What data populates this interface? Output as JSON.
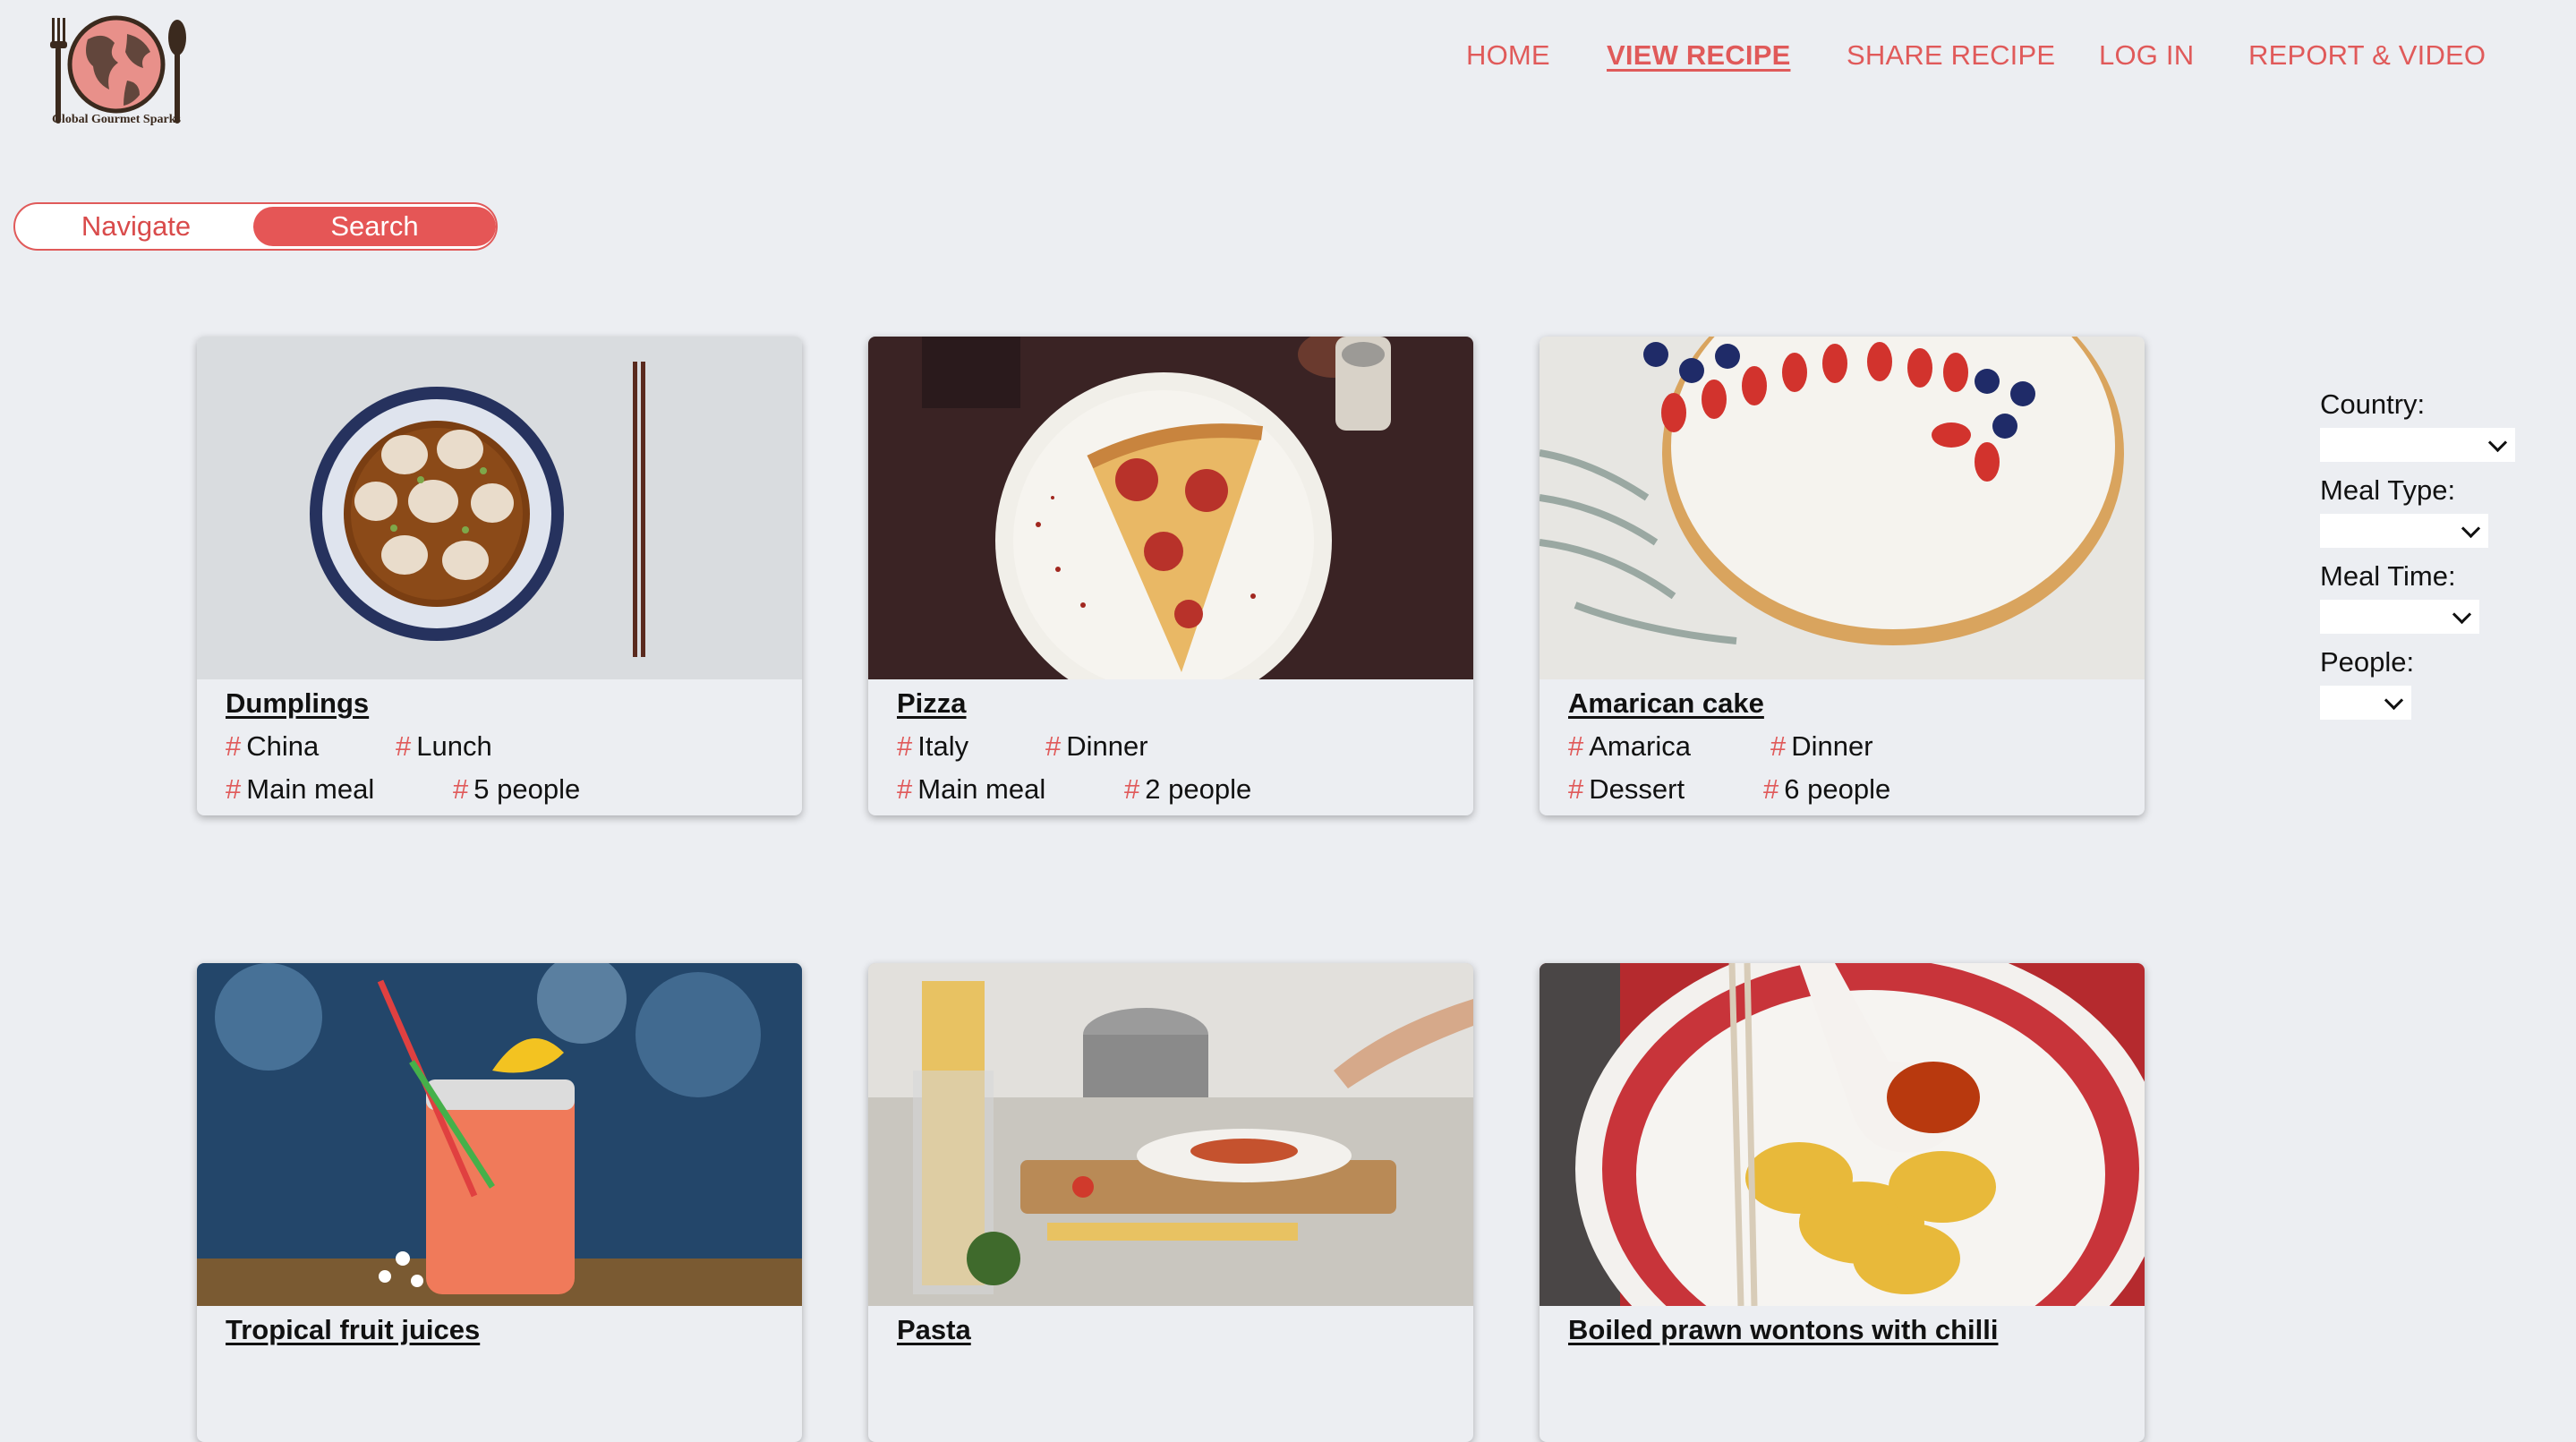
{
  "brand": {
    "name": "Global Gourmet Sparks"
  },
  "colors": {
    "accent": "#e05a5a",
    "background": "#eceef2"
  },
  "nav": {
    "items": [
      {
        "label": "HOME",
        "active": false
      },
      {
        "label": "VIEW RECIPE",
        "active": true
      },
      {
        "label": "SHARE RECIPE",
        "active": false
      },
      {
        "label": "LOG IN",
        "active": false
      },
      {
        "label": "REPORT & VIDEO",
        "active": false
      }
    ]
  },
  "toggle": {
    "navigate_label": "Navigate",
    "search_label": "Search",
    "selected": "Search"
  },
  "recipes": [
    {
      "title": "Dumplings",
      "country": "China",
      "meal_time": "Lunch",
      "meal_type": "Main meal",
      "people": "5 people"
    },
    {
      "title": "Pizza",
      "country": "Italy",
      "meal_time": "Dinner",
      "meal_type": "Main meal",
      "people": "2 people"
    },
    {
      "title": "Amarican cake",
      "country": "Amarica",
      "meal_time": "Dinner",
      "meal_type": "Dessert",
      "people": "6 people"
    },
    {
      "title": "Tropical fruit juices"
    },
    {
      "title": "Pasta"
    },
    {
      "title": "Boiled prawn wontons with chilli"
    }
  ],
  "filters": {
    "country_label": "Country:",
    "meal_type_label": "Meal Type:",
    "meal_time_label": "Meal Time:",
    "people_label": "People:"
  }
}
